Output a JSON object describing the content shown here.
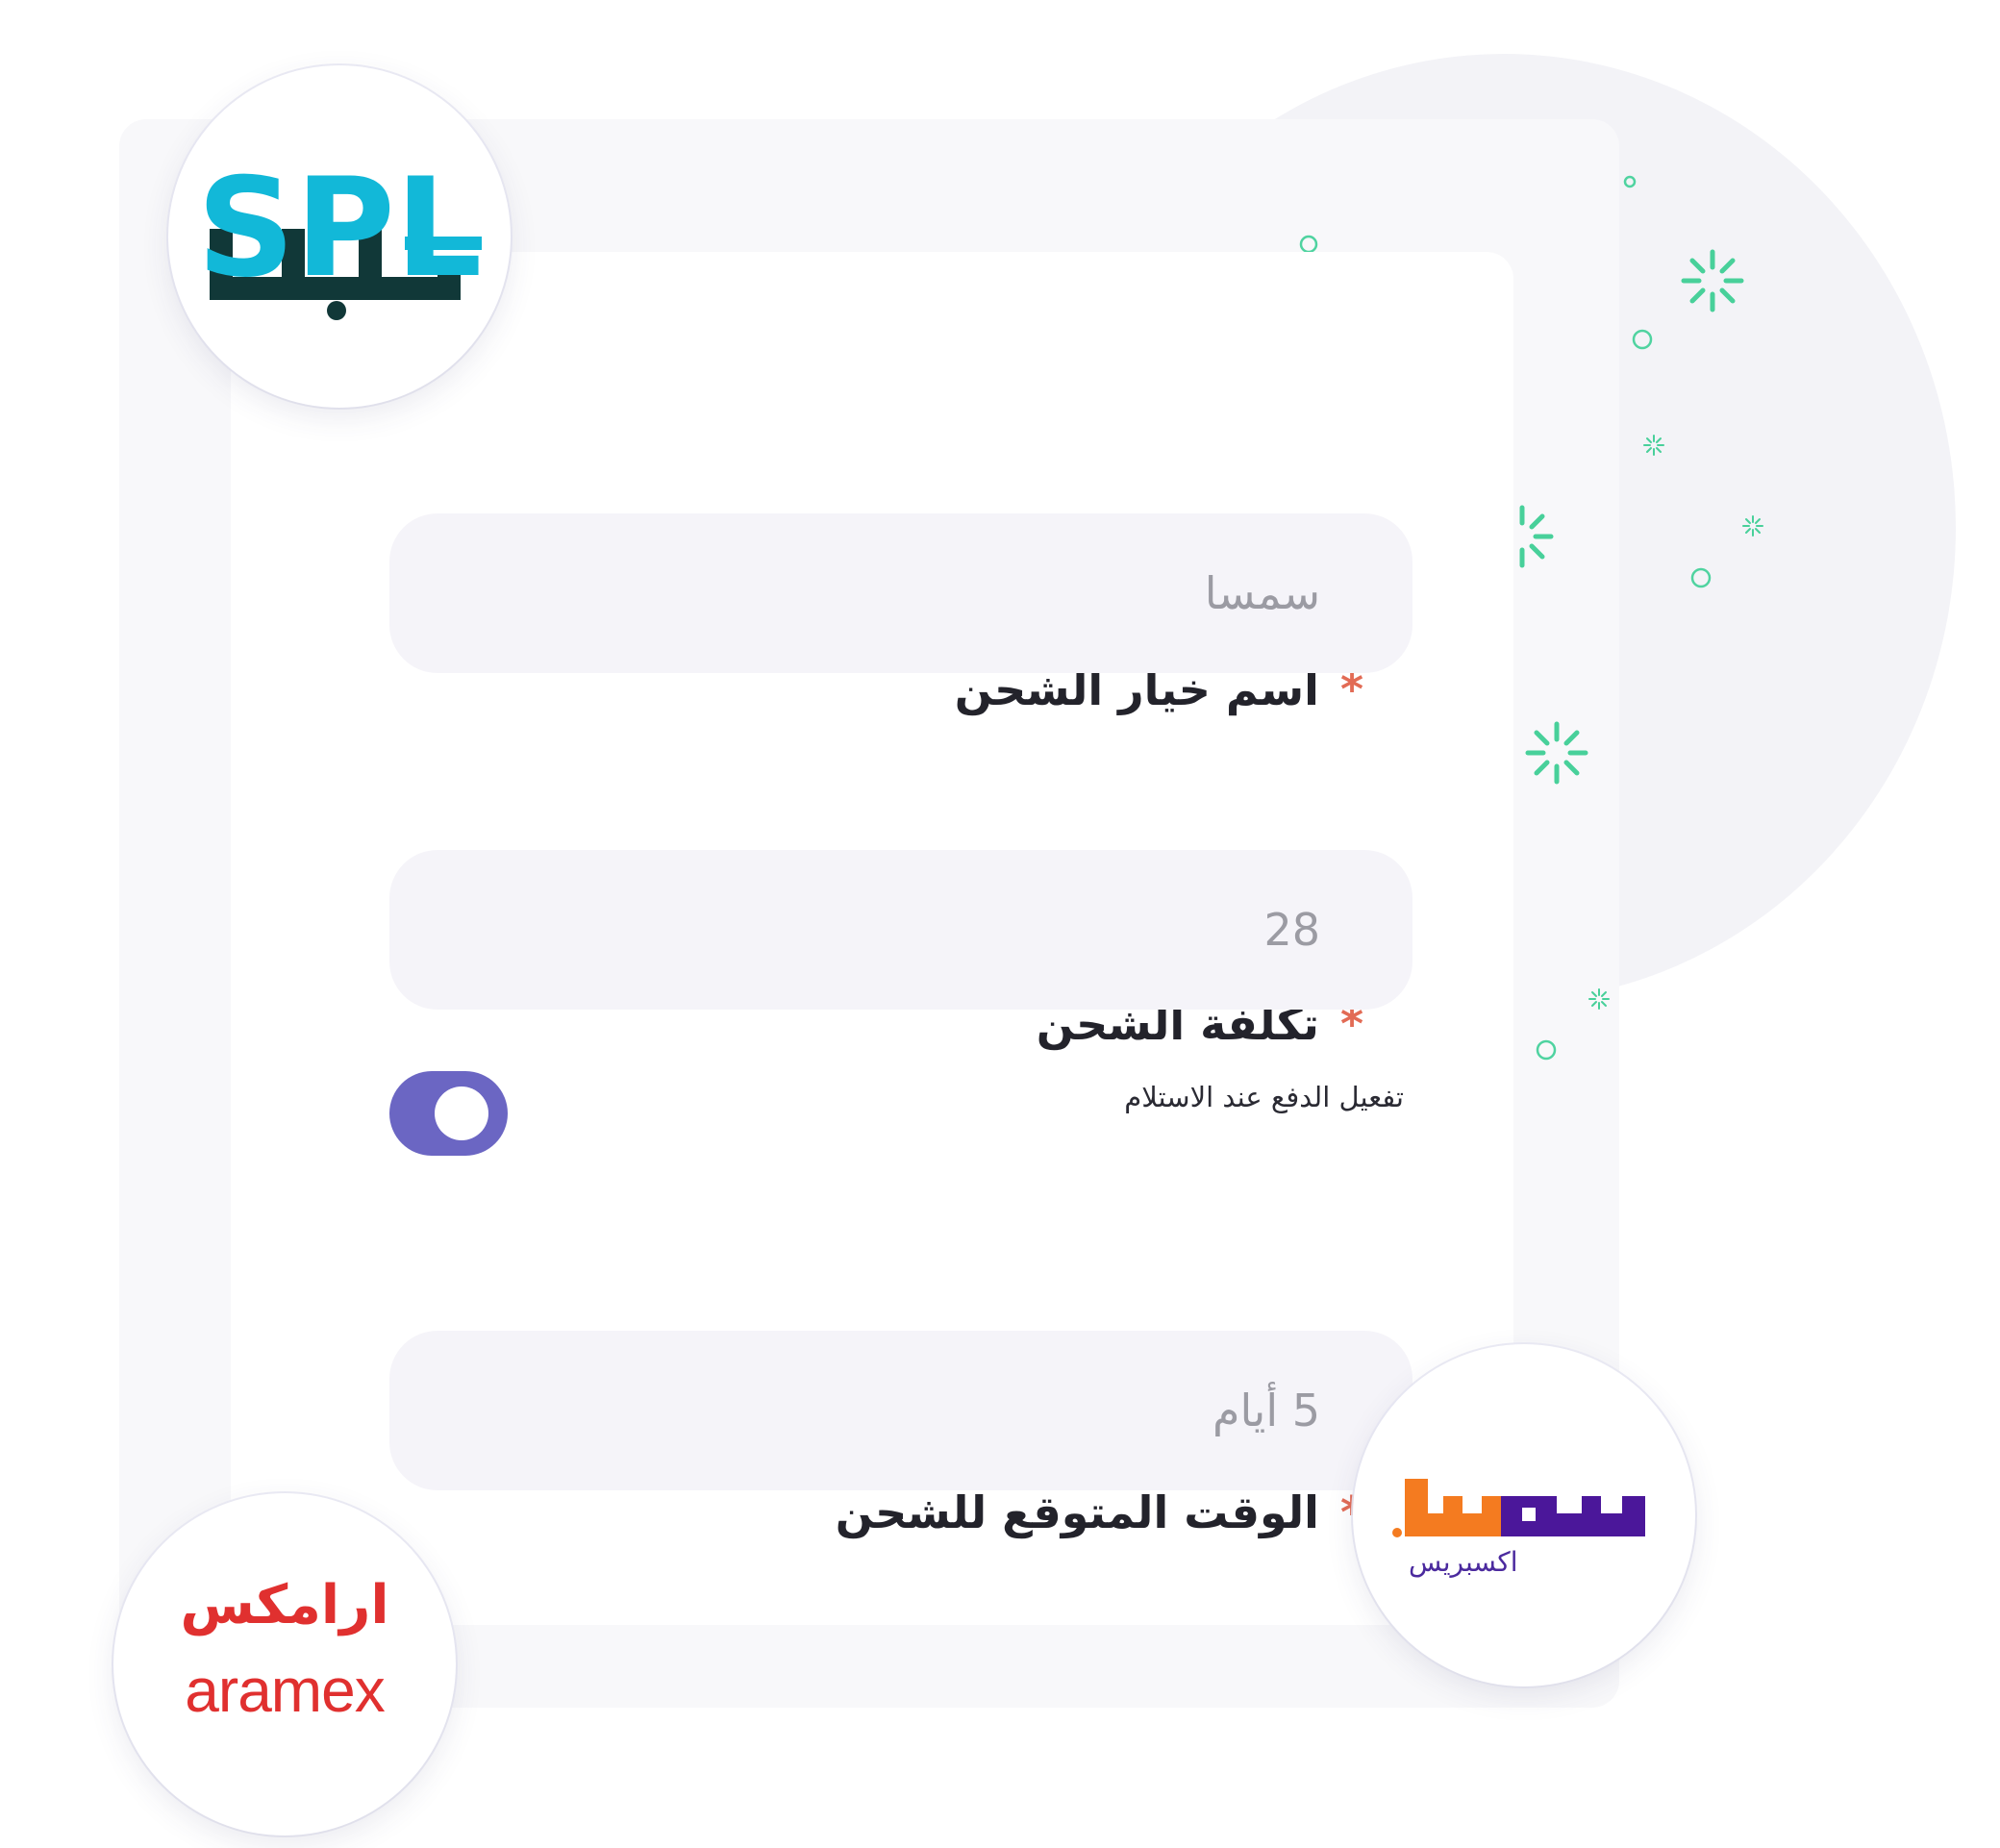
{
  "form": {
    "fields": [
      {
        "label": "اسم خيار الشحن",
        "required_mark": "*",
        "value": "سمسا"
      },
      {
        "label": "تكلفة الشحن",
        "required_mark": "*",
        "value": "28"
      },
      {
        "label": "الوقت المتوقع للشحن",
        "required_mark": "*",
        "value": "5 أيام"
      }
    ],
    "cod_toggle": {
      "label": "تفعيل الدفع عند الاستلام",
      "enabled": true
    }
  },
  "logos": {
    "spl": {
      "latin": "SPL",
      "arabic": "سبل"
    },
    "aramex": {
      "arabic": "ارامكس",
      "latin": "aramex"
    },
    "smsa": {
      "arabic": "سمسا",
      "subtitle": "اكسبريس"
    }
  },
  "colors": {
    "accent": "#6b66c3",
    "required": "#e26b55",
    "input_bg": "#f5f4f9",
    "spl_blue": "#12b8d8",
    "spl_dark": "#113838",
    "aramex_red": "#e0302f",
    "smsa_orange": "#f47b20",
    "smsa_purple": "#4b179a",
    "sparkle_green": "#48d09a"
  }
}
